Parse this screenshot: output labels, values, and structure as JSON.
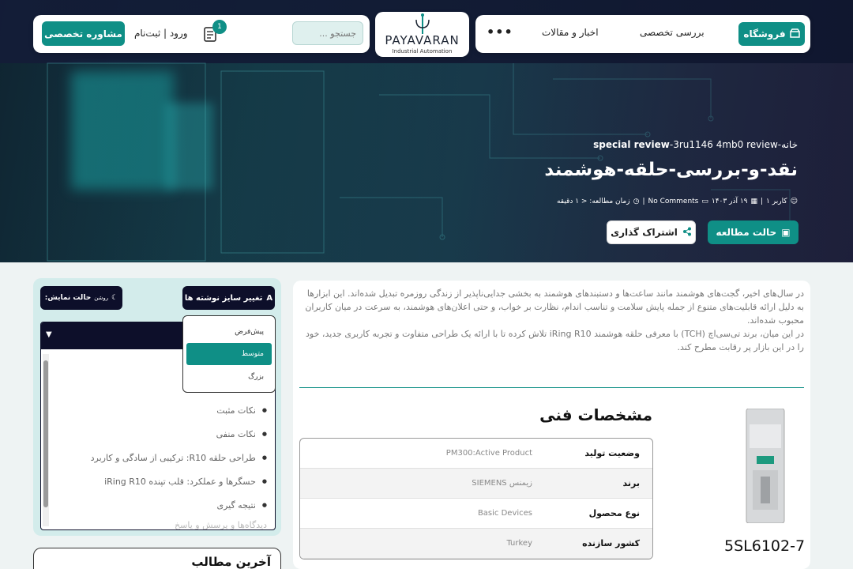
{
  "nav": {
    "shop": "فروشگاه",
    "review": "بررسی تخصصی",
    "news": "اخبار و مقالات",
    "more": "•••"
  },
  "logo": {
    "name": "PAYAVARAN",
    "tagline": "Industrial Automation"
  },
  "header": {
    "search_placeholder": "جستجو ...",
    "cart_count": "1",
    "login": "ورود | ثبت‌نام",
    "consult": "مشاوره تخصصی"
  },
  "hero": {
    "breadcrumb_home": "خانه",
    "breadcrumb_cat": "special review",
    "breadcrumb_tag": "3ru1146 4mb0 review",
    "title": "نقد-و-بررسی-حلقه-هوشمند",
    "author": "کاربر ۱",
    "date": "۱۹ آذر ۱۴۰۳",
    "comments": "No Comments",
    "read_time": "زمان مطالعه: < ۱ دقیقه",
    "reading_mode": "حالت مطالعه",
    "share": "اشتراک گذاری"
  },
  "content": {
    "intro": [
      "در سال‌های اخیر، گجت‌های هوشمند مانند ساعت‌ها و دستبندهای هوشمند به بخشی جدایی‌ناپذیر از زندگی روزمره تبدیل شده‌اند. این ابزارها به دلیل ارائه قابلیت‌های متنوع از جمله پایش سلامت و تناسب اندام، نظارت بر خواب، و حتی اعلان‌های هوشمند، به سرعت در میان کاربران محبوب شده‌اند.",
      "در این میان، برند تی‌سی‌اچ (TCH) با معرفی حلقه هوشمند iRing R10 تلاش کرده تا با ارائه یک طراحی متفاوت و تجربه کاربری جدید، خود را در این بازار پر رقابت مطرح کند."
    ],
    "spec_title": "مشخصات فنی",
    "product_code": "5SL6102-7",
    "specs": [
      {
        "key": "وضعیت تولید",
        "value": "PM300:Active Product"
      },
      {
        "key": "برند",
        "value": "زیمنس SIEMENS"
      },
      {
        "key": "نوع محصول",
        "value": "Basic Devices"
      },
      {
        "key": "کشور سازنده",
        "value": "Turkey"
      }
    ]
  },
  "sidebar": {
    "font_size": "تغییر سایز نوشته ها",
    "display_mode": "حالت نمایش:",
    "display_mode_value": "روشن",
    "size_options": [
      "پیش‌فرض",
      "متوسط",
      "بزرگ"
    ],
    "size_selected": 1,
    "toc": [
      "نکات مثبت",
      "نکات منفی",
      "طراحی حلقه R10: ترکیبی از سادگی و کاربرد",
      "حسگرها و عملکرد: قلب تپنده iRing R10",
      "نتیجه گیری"
    ],
    "toc_partial": "دیدگاه‌ها و پرسش و پاسخ",
    "recent_title": "آخرین مطالب"
  },
  "colors": {
    "accent": "#0f8f86",
    "dark": "#0d0f2a"
  }
}
